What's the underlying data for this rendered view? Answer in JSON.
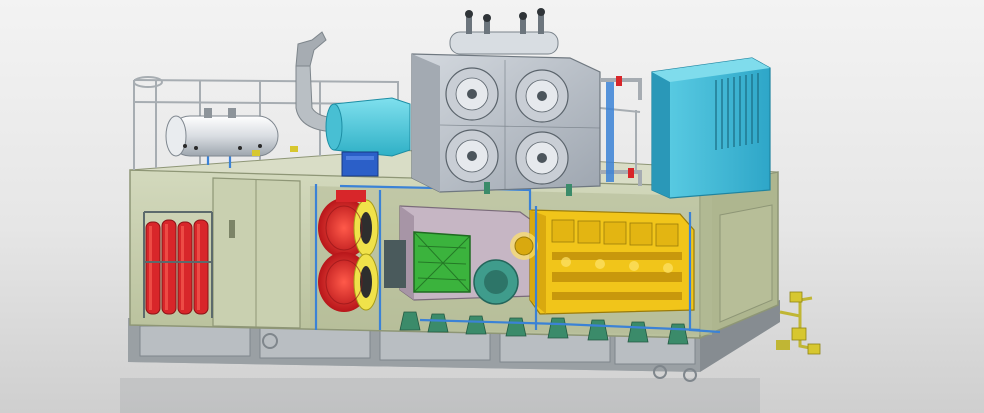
{
  "scene": {
    "subject": "",
    "colors": {
      "background_top": "#f3f3f3",
      "background_bottom": "#cfcfcf",
      "container": "#c7cfae",
      "container_dark": "#aab28e",
      "base_frame": "#9ea4a8",
      "radiator": "#b9c0c8",
      "cooler": "#36b7d6",
      "generator": "#c6b6c4",
      "alternator_face": "#3bb33d",
      "engine": "#f1c51a",
      "fire_cylinders": "#d8262a",
      "cable_reels": "#d8262a",
      "exhaust_silencer": "#56c6d8",
      "pipework": "#3b82d6",
      "junction_box": "#2b5fc8",
      "supports": "#3b8b6a",
      "valves": "#d7c72f"
    }
  }
}
